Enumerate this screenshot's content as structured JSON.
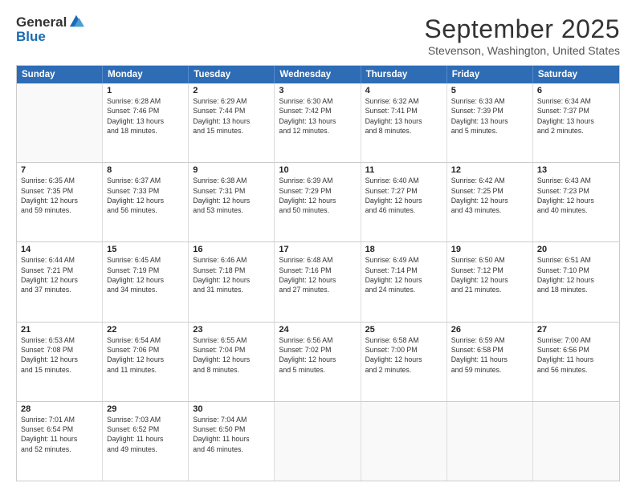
{
  "logo": {
    "general": "General",
    "blue": "Blue"
  },
  "title": "September 2025",
  "location": "Stevenson, Washington, United States",
  "headers": [
    "Sunday",
    "Monday",
    "Tuesday",
    "Wednesday",
    "Thursday",
    "Friday",
    "Saturday"
  ],
  "rows": [
    [
      {
        "day": "",
        "info": ""
      },
      {
        "day": "1",
        "info": "Sunrise: 6:28 AM\nSunset: 7:46 PM\nDaylight: 13 hours\nand 18 minutes."
      },
      {
        "day": "2",
        "info": "Sunrise: 6:29 AM\nSunset: 7:44 PM\nDaylight: 13 hours\nand 15 minutes."
      },
      {
        "day": "3",
        "info": "Sunrise: 6:30 AM\nSunset: 7:42 PM\nDaylight: 13 hours\nand 12 minutes."
      },
      {
        "day": "4",
        "info": "Sunrise: 6:32 AM\nSunset: 7:41 PM\nDaylight: 13 hours\nand 8 minutes."
      },
      {
        "day": "5",
        "info": "Sunrise: 6:33 AM\nSunset: 7:39 PM\nDaylight: 13 hours\nand 5 minutes."
      },
      {
        "day": "6",
        "info": "Sunrise: 6:34 AM\nSunset: 7:37 PM\nDaylight: 13 hours\nand 2 minutes."
      }
    ],
    [
      {
        "day": "7",
        "info": "Sunrise: 6:35 AM\nSunset: 7:35 PM\nDaylight: 12 hours\nand 59 minutes."
      },
      {
        "day": "8",
        "info": "Sunrise: 6:37 AM\nSunset: 7:33 PM\nDaylight: 12 hours\nand 56 minutes."
      },
      {
        "day": "9",
        "info": "Sunrise: 6:38 AM\nSunset: 7:31 PM\nDaylight: 12 hours\nand 53 minutes."
      },
      {
        "day": "10",
        "info": "Sunrise: 6:39 AM\nSunset: 7:29 PM\nDaylight: 12 hours\nand 50 minutes."
      },
      {
        "day": "11",
        "info": "Sunrise: 6:40 AM\nSunset: 7:27 PM\nDaylight: 12 hours\nand 46 minutes."
      },
      {
        "day": "12",
        "info": "Sunrise: 6:42 AM\nSunset: 7:25 PM\nDaylight: 12 hours\nand 43 minutes."
      },
      {
        "day": "13",
        "info": "Sunrise: 6:43 AM\nSunset: 7:23 PM\nDaylight: 12 hours\nand 40 minutes."
      }
    ],
    [
      {
        "day": "14",
        "info": "Sunrise: 6:44 AM\nSunset: 7:21 PM\nDaylight: 12 hours\nand 37 minutes."
      },
      {
        "day": "15",
        "info": "Sunrise: 6:45 AM\nSunset: 7:19 PM\nDaylight: 12 hours\nand 34 minutes."
      },
      {
        "day": "16",
        "info": "Sunrise: 6:46 AM\nSunset: 7:18 PM\nDaylight: 12 hours\nand 31 minutes."
      },
      {
        "day": "17",
        "info": "Sunrise: 6:48 AM\nSunset: 7:16 PM\nDaylight: 12 hours\nand 27 minutes."
      },
      {
        "day": "18",
        "info": "Sunrise: 6:49 AM\nSunset: 7:14 PM\nDaylight: 12 hours\nand 24 minutes."
      },
      {
        "day": "19",
        "info": "Sunrise: 6:50 AM\nSunset: 7:12 PM\nDaylight: 12 hours\nand 21 minutes."
      },
      {
        "day": "20",
        "info": "Sunrise: 6:51 AM\nSunset: 7:10 PM\nDaylight: 12 hours\nand 18 minutes."
      }
    ],
    [
      {
        "day": "21",
        "info": "Sunrise: 6:53 AM\nSunset: 7:08 PM\nDaylight: 12 hours\nand 15 minutes."
      },
      {
        "day": "22",
        "info": "Sunrise: 6:54 AM\nSunset: 7:06 PM\nDaylight: 12 hours\nand 11 minutes."
      },
      {
        "day": "23",
        "info": "Sunrise: 6:55 AM\nSunset: 7:04 PM\nDaylight: 12 hours\nand 8 minutes."
      },
      {
        "day": "24",
        "info": "Sunrise: 6:56 AM\nSunset: 7:02 PM\nDaylight: 12 hours\nand 5 minutes."
      },
      {
        "day": "25",
        "info": "Sunrise: 6:58 AM\nSunset: 7:00 PM\nDaylight: 12 hours\nand 2 minutes."
      },
      {
        "day": "26",
        "info": "Sunrise: 6:59 AM\nSunset: 6:58 PM\nDaylight: 11 hours\nand 59 minutes."
      },
      {
        "day": "27",
        "info": "Sunrise: 7:00 AM\nSunset: 6:56 PM\nDaylight: 11 hours\nand 56 minutes."
      }
    ],
    [
      {
        "day": "28",
        "info": "Sunrise: 7:01 AM\nSunset: 6:54 PM\nDaylight: 11 hours\nand 52 minutes."
      },
      {
        "day": "29",
        "info": "Sunrise: 7:03 AM\nSunset: 6:52 PM\nDaylight: 11 hours\nand 49 minutes."
      },
      {
        "day": "30",
        "info": "Sunrise: 7:04 AM\nSunset: 6:50 PM\nDaylight: 11 hours\nand 46 minutes."
      },
      {
        "day": "",
        "info": ""
      },
      {
        "day": "",
        "info": ""
      },
      {
        "day": "",
        "info": ""
      },
      {
        "day": "",
        "info": ""
      }
    ]
  ]
}
